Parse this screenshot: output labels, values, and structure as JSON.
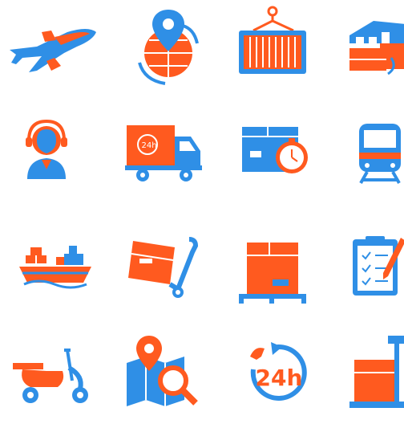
{
  "colors": {
    "orange": "#ff5a1f",
    "blue": "#2f8fe6"
  },
  "icons": [
    {
      "name": "airplane-icon"
    },
    {
      "name": "globe-location-pin-icon"
    },
    {
      "name": "shipping-container-icon"
    },
    {
      "name": "warehouse-icon"
    },
    {
      "name": "support-operator-icon"
    },
    {
      "name": "delivery-truck-24h-icon"
    },
    {
      "name": "package-stopwatch-icon"
    },
    {
      "name": "train-icon"
    },
    {
      "name": "cargo-ship-icon"
    },
    {
      "name": "hand-truck-box-icon"
    },
    {
      "name": "pallet-box-icon"
    },
    {
      "name": "clipboard-checklist-icon"
    },
    {
      "name": "delivery-scooter-icon"
    },
    {
      "name": "map-search-icon"
    },
    {
      "name": "24h-service-icon"
    },
    {
      "name": "box-on-scale-icon"
    }
  ],
  "labels": {
    "truck_badge": "24h",
    "service_badge": "24h"
  }
}
